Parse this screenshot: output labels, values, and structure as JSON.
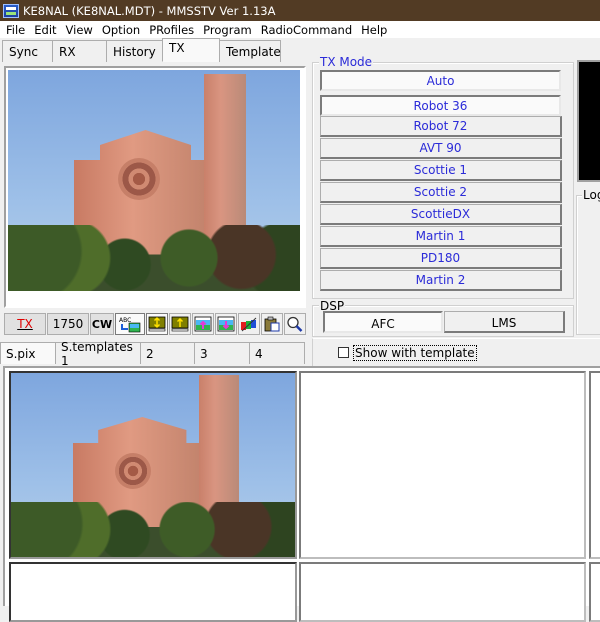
{
  "window": {
    "title": "KE8NAL (KE8NAL.MDT) - MMSSTV Ver 1.13A"
  },
  "menu": [
    "File",
    "Edit",
    "View",
    "Option",
    "PRofiles",
    "Program",
    "RadioCommand",
    "Help"
  ],
  "main_tabs": [
    {
      "label": "Sync",
      "active": false
    },
    {
      "label": "RX",
      "active": false
    },
    {
      "label": "History",
      "active": false
    },
    {
      "label": "TX",
      "active": true
    },
    {
      "label": "Template",
      "active": false
    }
  ],
  "tx_image": {
    "subject": "church-with-bell-tower"
  },
  "toolbar": {
    "tx_label": "TX",
    "tx_color": "#e00000",
    "tone_label": "1750",
    "cw_label": "CW",
    "icons": [
      "text-to-image-icon",
      "move-up-down-icon",
      "move-up-icon",
      "image-up-arrow-icon",
      "image-down-arrow-icon",
      "color-bars-icon",
      "clipboard-paste-icon",
      "zoom-icon"
    ]
  },
  "tx_mode": {
    "legend": "TX Mode",
    "text_color": "#2b2bd8",
    "modes": [
      {
        "label": "Auto",
        "pressed": true
      },
      {
        "label": "Robot 36",
        "pressed": true
      },
      {
        "label": "Robot 72",
        "pressed": false
      },
      {
        "label": "AVT 90",
        "pressed": false
      },
      {
        "label": "Scottie 1",
        "pressed": false
      },
      {
        "label": "Scottie 2",
        "pressed": false
      },
      {
        "label": "ScottieDX",
        "pressed": false
      },
      {
        "label": "Martin 1",
        "pressed": false
      },
      {
        "label": "PD180",
        "pressed": false
      },
      {
        "label": "Martin 2",
        "pressed": false
      }
    ]
  },
  "dsp": {
    "legend": "DSP",
    "buttons": [
      {
        "label": "AFC",
        "pressed": true
      },
      {
        "label": "LMS",
        "pressed": false
      }
    ]
  },
  "log": {
    "legend": "Log"
  },
  "lower_tabs": [
    {
      "label": "S.pix",
      "active": true
    },
    {
      "label": "S.templates 1",
      "active": false
    },
    {
      "label": "2",
      "active": false
    },
    {
      "label": "3",
      "active": false
    },
    {
      "label": "4",
      "active": false
    }
  ],
  "show_with_template": {
    "label": "Show with template",
    "checked": false
  }
}
